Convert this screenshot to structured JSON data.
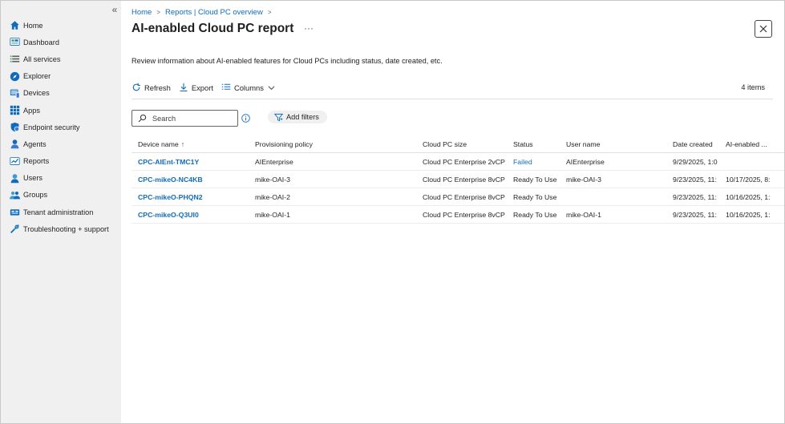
{
  "sidebar": {
    "collapse_glyph": "«",
    "items": [
      {
        "label": "Home",
        "icon": "home-icon",
        "color": "#0f6cbd"
      },
      {
        "label": "Dashboard",
        "icon": "dashboard-icon",
        "color": "#0f6cbd"
      },
      {
        "label": "All services",
        "icon": "list-icon",
        "color": "#0f6cbd"
      },
      {
        "label": "Explorer",
        "icon": "explorer-icon",
        "color": "#0f6cbd"
      },
      {
        "label": "Devices",
        "icon": "devices-icon",
        "color": "#0f6cbd"
      },
      {
        "label": "Apps",
        "icon": "apps-icon",
        "color": "#0f6cbd"
      },
      {
        "label": "Endpoint security",
        "icon": "shield-icon",
        "color": "#0f6cbd"
      },
      {
        "label": "Agents",
        "icon": "agents-icon",
        "color": "#0f6cbd"
      },
      {
        "label": "Reports",
        "icon": "reports-icon",
        "color": "#0f6cbd"
      },
      {
        "label": "Users",
        "icon": "user-icon",
        "color": "#0f6cbd"
      },
      {
        "label": "Groups",
        "icon": "groups-icon",
        "color": "#0f6cbd"
      },
      {
        "label": "Tenant administration",
        "icon": "tenant-icon",
        "color": "#0f6cbd"
      },
      {
        "label": "Troubleshooting + support",
        "icon": "tools-icon",
        "color": "#0f6cbd"
      }
    ]
  },
  "breadcrumb": {
    "home": "Home",
    "parent": "Reports | Cloud PC overview",
    "sep": ">"
  },
  "page": {
    "title": "AI-enabled Cloud PC report",
    "more": "···",
    "description": "Review information about AI-enabled features for Cloud PCs including status, date created, etc."
  },
  "toolbar": {
    "refresh": "Refresh",
    "export": "Export",
    "columns": "Columns",
    "items_count": "4 items"
  },
  "search": {
    "placeholder": "Search"
  },
  "filters": {
    "add_label": "Add filters"
  },
  "table": {
    "headers": [
      "Device name",
      "Provisioning policy",
      "Cloud PC size",
      "Status",
      "User name",
      "Date created",
      "AI-enabled ..."
    ],
    "sort_glyph": "↑",
    "rows": [
      [
        "CPC-AIEnt-TMC1Y",
        "AIEnterprise",
        "Cloud PC Enterprise 2vCP",
        "Failed",
        "AIEnterprise",
        "9/29/2025, 1:0",
        ""
      ],
      [
        "CPC-mikeO-NC4KB",
        "mike-OAI-3",
        "Cloud PC Enterprise 8vCP",
        "Ready To Use",
        "mike-OAI-3",
        "9/23/2025, 11:",
        "10/17/2025, 8:"
      ],
      [
        "CPC-mikeO-PHQN2",
        "mike-OAI-2",
        "Cloud PC Enterprise 8vCP",
        "Ready To Use",
        "",
        "9/23/2025, 11:",
        "10/16/2025, 1:"
      ],
      [
        "CPC-mikeO-Q3UI0",
        "mike-OAI-1",
        "Cloud PC Enterprise 8vCP",
        "Ready To Use",
        "mike-OAI-1",
        "9/23/2025, 11:",
        "10/16/2025, 1:"
      ]
    ]
  },
  "colors": {
    "accent": "#0f6cbd",
    "sidebar_bg": "#f0f0f0"
  }
}
